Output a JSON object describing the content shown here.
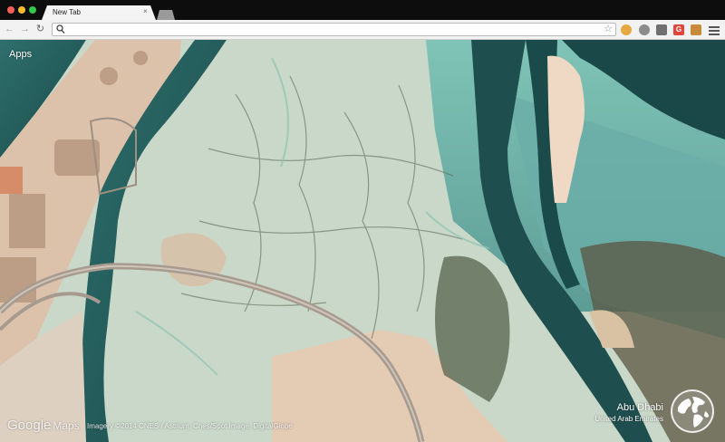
{
  "tab": {
    "title": "New Tab",
    "close_glyph": "×"
  },
  "toolbar": {
    "back_glyph": "←",
    "forward_glyph": "→",
    "reload_glyph": "↻",
    "star_glyph": "☆",
    "omnibox_value": "",
    "extensions": [
      {
        "icon": "cookie-extension-icon",
        "glyph": ""
      },
      {
        "icon": "globe-extension-icon",
        "glyph": ""
      },
      {
        "icon": "inbox-extension-icon",
        "glyph": ""
      },
      {
        "icon": "g-extension-icon",
        "glyph": "G"
      },
      {
        "icon": "face-extension-icon",
        "glyph": ""
      }
    ]
  },
  "content": {
    "apps_label": "Apps",
    "google_label": "Google",
    "maps_label": "Maps",
    "imagery_credit": "Imagery ©2014 CNES / Astrium, Cnes/Spot Image, DigitalGlobe",
    "place_name": "Abu Dhabi",
    "place_country": "United Arab Emirates"
  },
  "colors": {
    "water_dark": "#1f4e4f",
    "water_shallow": "#6fb5ac",
    "sand": "#e4cbb4",
    "marsh": "#c7d6c7",
    "road": "#a79b90"
  }
}
